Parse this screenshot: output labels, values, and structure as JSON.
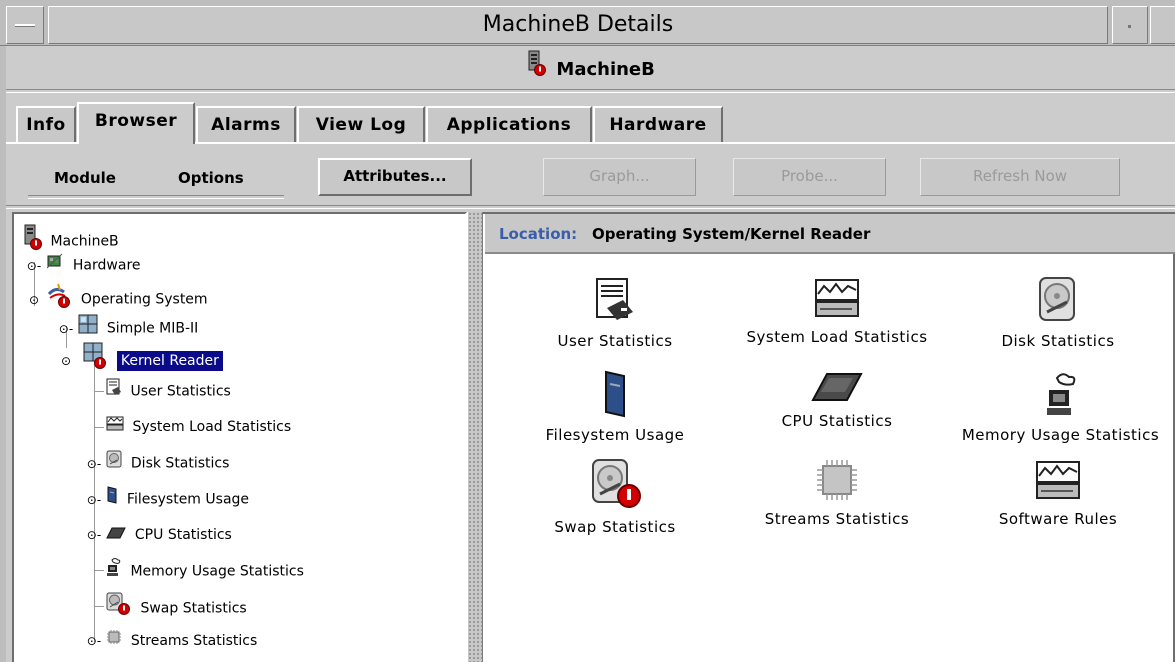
{
  "window": {
    "title": "MachineB Details"
  },
  "host": {
    "name": "MachineB"
  },
  "tabs": [
    {
      "label": "Info",
      "active": false
    },
    {
      "label": "Browser",
      "active": true
    },
    {
      "label": "Alarms",
      "active": false
    },
    {
      "label": "View Log",
      "active": false
    },
    {
      "label": "Applications",
      "active": false
    },
    {
      "label": "Hardware",
      "active": false
    }
  ],
  "toolbar": {
    "module_label": "Module",
    "options_label": "Options",
    "attributes_label": "Attributes...",
    "graph_label": "Graph...",
    "probe_label": "Probe...",
    "refresh_label": "Refresh Now"
  },
  "tree": {
    "items": [
      {
        "label": "MachineB",
        "icon": "server-icon",
        "alarm": true
      },
      {
        "label": "Hardware",
        "icon": "hardware-icon",
        "expander": "collapsed"
      },
      {
        "label": "Operating System",
        "icon": "os-icon",
        "expander": "expanded",
        "alarm": true
      },
      {
        "label": "Simple MIB-II",
        "icon": "module-icon",
        "expander": "collapsed"
      },
      {
        "label": "Kernel Reader",
        "icon": "module-icon",
        "expander": "expanded",
        "alarm": true,
        "selected": true
      },
      {
        "label": "User Statistics",
        "icon": "user-stats-icon"
      },
      {
        "label": "System Load Statistics",
        "icon": "load-stats-icon"
      },
      {
        "label": "Disk Statistics",
        "icon": "disk-icon",
        "expander": "collapsed"
      },
      {
        "label": "Filesystem Usage",
        "icon": "filesystem-icon",
        "expander": "collapsed"
      },
      {
        "label": "CPU Statistics",
        "icon": "cpu-icon",
        "expander": "collapsed"
      },
      {
        "label": "Memory Usage Statistics",
        "icon": "memory-icon"
      },
      {
        "label": "Swap Statistics",
        "icon": "swap-icon",
        "alarm": true
      },
      {
        "label": "Streams Statistics",
        "icon": "streams-icon",
        "expander": "collapsed"
      }
    ]
  },
  "location": {
    "label": "Location:",
    "value": "Operating System/Kernel Reader"
  },
  "grid": [
    {
      "label": "User Statistics",
      "icon": "user-stats-icon"
    },
    {
      "label": "System Load Statistics",
      "icon": "load-stats-icon"
    },
    {
      "label": "Disk Statistics",
      "icon": "disk-icon"
    },
    {
      "label": "Filesystem Usage",
      "icon": "filesystem-icon"
    },
    {
      "label": "CPU Statistics",
      "icon": "cpu-icon"
    },
    {
      "label": "Memory Usage Statistics",
      "icon": "memory-icon"
    },
    {
      "label": "Swap Statistics",
      "icon": "swap-icon",
      "alarm": true
    },
    {
      "label": "Streams Statistics",
      "icon": "streams-icon"
    },
    {
      "label": "Software Rules",
      "icon": "rules-icon"
    }
  ],
  "colors": {
    "selection": "#0b0b8a",
    "alarm": "#d40000",
    "location_label": "#3a5ea8"
  }
}
